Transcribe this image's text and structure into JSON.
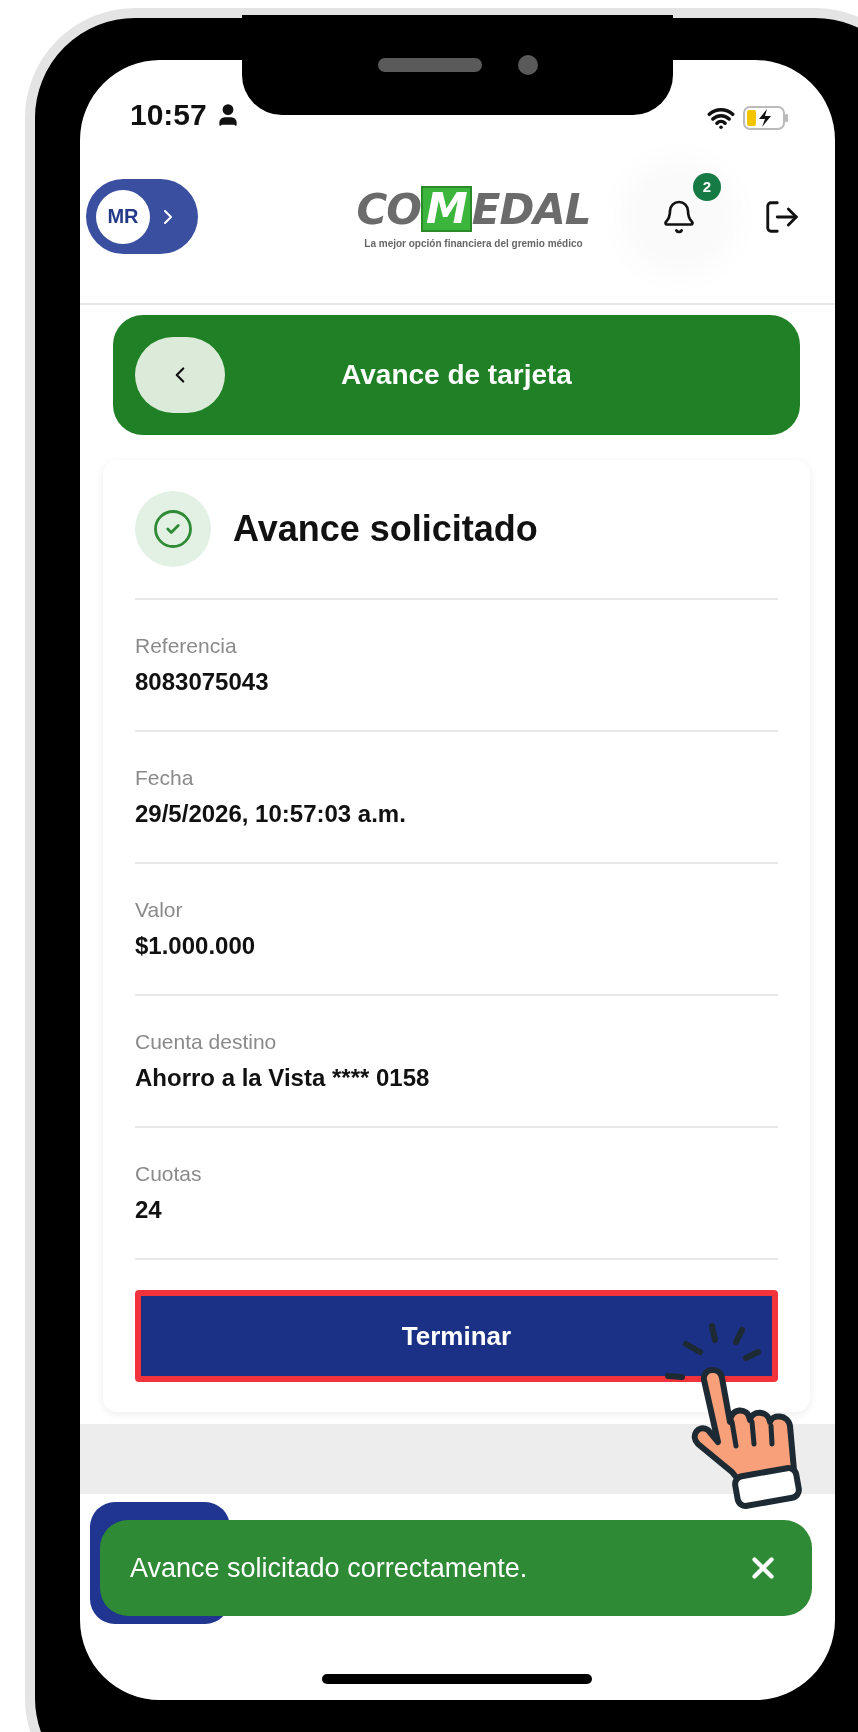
{
  "status_bar": {
    "time": "10:57"
  },
  "header": {
    "avatar_initials": "MR",
    "logo": {
      "parts": [
        {
          "text": "CO",
          "highlighted": false
        },
        {
          "text": "M",
          "highlighted": true
        },
        {
          "text": "EDAL",
          "highlighted": false
        }
      ],
      "tagline": "La mejor opción financiera del gremio médico"
    },
    "notification_count": "2"
  },
  "banner": {
    "title": "Avance de tarjeta"
  },
  "card": {
    "title": "Avance solicitado",
    "fields": [
      {
        "label": "Referencia",
        "value": "8083075043"
      },
      {
        "label": "Fecha",
        "value": "29/5/2026, 10:57:03 a.m."
      },
      {
        "label": "Valor",
        "value": "$1.000.000"
      },
      {
        "label": "Cuenta destino",
        "value": "Ahorro a la Vista **** 0158"
      },
      {
        "label": "Cuotas",
        "value": "24"
      }
    ],
    "button": {
      "label": "Terminar",
      "highlighted": true
    }
  },
  "toast": {
    "message": "Avance solicitado correctamente."
  }
}
